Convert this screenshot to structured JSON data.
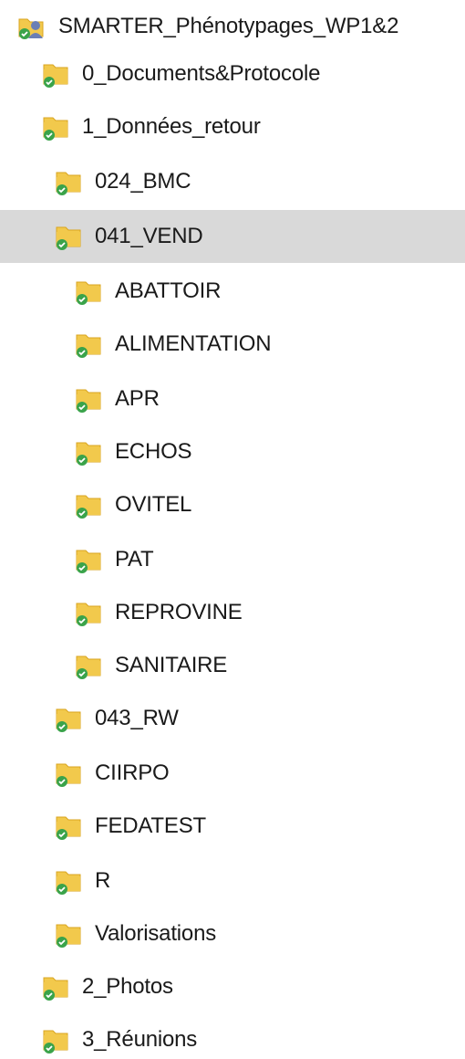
{
  "tree": {
    "root": {
      "label": "SMARTER_Phénotypages_WP1&2",
      "icon": "shared-folder-sync-icon"
    },
    "items": [
      {
        "label": "0_Documents&Protocole",
        "level": 1,
        "icon": "folder-sync-icon"
      },
      {
        "label": "1_Données_retour",
        "level": 1,
        "icon": "folder-sync-icon"
      },
      {
        "label": "024_BMC",
        "level": 2,
        "icon": "folder-sync-icon"
      },
      {
        "label": "041_VEND",
        "level": 2,
        "icon": "folder-sync-icon",
        "selected": true
      },
      {
        "label": "ABATTOIR",
        "level": 3,
        "icon": "folder-sync-icon"
      },
      {
        "label": "ALIMENTATION",
        "level": 3,
        "icon": "folder-sync-icon"
      },
      {
        "label": "APR",
        "level": 3,
        "icon": "folder-sync-icon"
      },
      {
        "label": "ECHOS",
        "level": 3,
        "icon": "folder-sync-icon"
      },
      {
        "label": "OVITEL",
        "level": 3,
        "icon": "folder-sync-icon"
      },
      {
        "label": "PAT",
        "level": 3,
        "icon": "folder-sync-icon"
      },
      {
        "label": "REPROVINE",
        "level": 3,
        "icon": "folder-sync-icon"
      },
      {
        "label": "SANITAIRE",
        "level": 3,
        "icon": "folder-sync-icon"
      },
      {
        "label": "043_RW",
        "level": 2,
        "icon": "folder-sync-icon"
      },
      {
        "label": "CIIRPO",
        "level": 2,
        "icon": "folder-sync-icon"
      },
      {
        "label": "FEDATEST",
        "level": 2,
        "icon": "folder-sync-icon"
      },
      {
        "label": "R",
        "level": 2,
        "icon": "folder-sync-icon"
      },
      {
        "label": "Valorisations",
        "level": 2,
        "icon": "folder-sync-icon"
      },
      {
        "label": "2_Photos",
        "level": 1,
        "icon": "folder-sync-icon"
      },
      {
        "label": "3_Réunions",
        "level": 1,
        "icon": "folder-sync-icon"
      }
    ]
  },
  "colors": {
    "folder": "#f2c94c",
    "folder_dark": "#d9a520",
    "sync_badge": "#3aa34a",
    "selection": "#d9d9d9"
  }
}
